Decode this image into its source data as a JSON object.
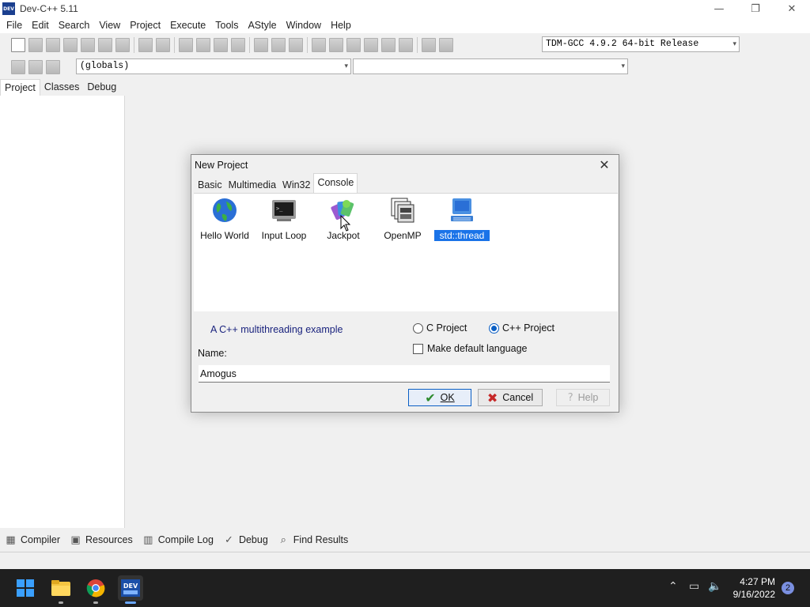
{
  "window": {
    "title": "Dev-C++ 5.11",
    "icon_text": "DEV",
    "controls": {
      "minimize": "—",
      "restore": "❐",
      "close": "✕"
    }
  },
  "menu": [
    "File",
    "Edit",
    "Search",
    "View",
    "Project",
    "Execute",
    "Tools",
    "AStyle",
    "Window",
    "Help"
  ],
  "toolbar": {
    "compiler_select": "TDM-GCC 4.9.2 64-bit Release",
    "scope_select": "(globals)",
    "member_select": "",
    "dropdown_arrow": "▾"
  },
  "side_tabs": [
    "Project",
    "Classes",
    "Debug"
  ],
  "bottom_tabs": [
    {
      "label": "Compiler",
      "icon": "grid-icon"
    },
    {
      "label": "Resources",
      "icon": "resources-icon"
    },
    {
      "label": "Compile Log",
      "icon": "chart-icon"
    },
    {
      "label": "Debug",
      "icon": "check-icon"
    },
    {
      "label": "Find Results",
      "icon": "search-doc-icon"
    }
  ],
  "dialog": {
    "title": "New Project",
    "close_glyph": "✕",
    "tabs": [
      "Basic",
      "Multimedia",
      "Win32",
      "Console"
    ],
    "active_tab": "Console",
    "templates": [
      {
        "label": "Hello World",
        "icon": "globe-icon"
      },
      {
        "label": "Input Loop",
        "icon": "terminal-icon"
      },
      {
        "label": "Jackpot",
        "icon": "cards-icon"
      },
      {
        "label": "OpenMP",
        "icon": "stacked-windows-icon"
      },
      {
        "label": "std::thread",
        "icon": "computer-icon",
        "selected": true
      }
    ],
    "description": "A C++ multithreading example",
    "radio_c": "C Project",
    "radio_cpp": "C++ Project",
    "selected_language": "C++ Project",
    "default_language_label": "Make default language",
    "name_label": "Name:",
    "name_value": "Amogus",
    "buttons": {
      "ok": "OK",
      "cancel": "Cancel",
      "help": "Help"
    },
    "button_glyphs": {
      "ok": "✔",
      "cancel": "✖",
      "help": "?"
    }
  },
  "taskbar": {
    "time": "4:27 PM",
    "date": "9/16/2022",
    "notification_count": "2",
    "tray_glyphs": {
      "chevron": "⌃",
      "network": "▭",
      "volume": "🔈"
    },
    "pinned": [
      "start-icon",
      "file-explorer-icon",
      "chrome-icon",
      "devcpp-icon"
    ]
  },
  "colors": {
    "accent": "#0b5fc4",
    "selection": "#1a73e8",
    "description_text": "#1a237e",
    "taskbar": "#1f1f1f"
  }
}
